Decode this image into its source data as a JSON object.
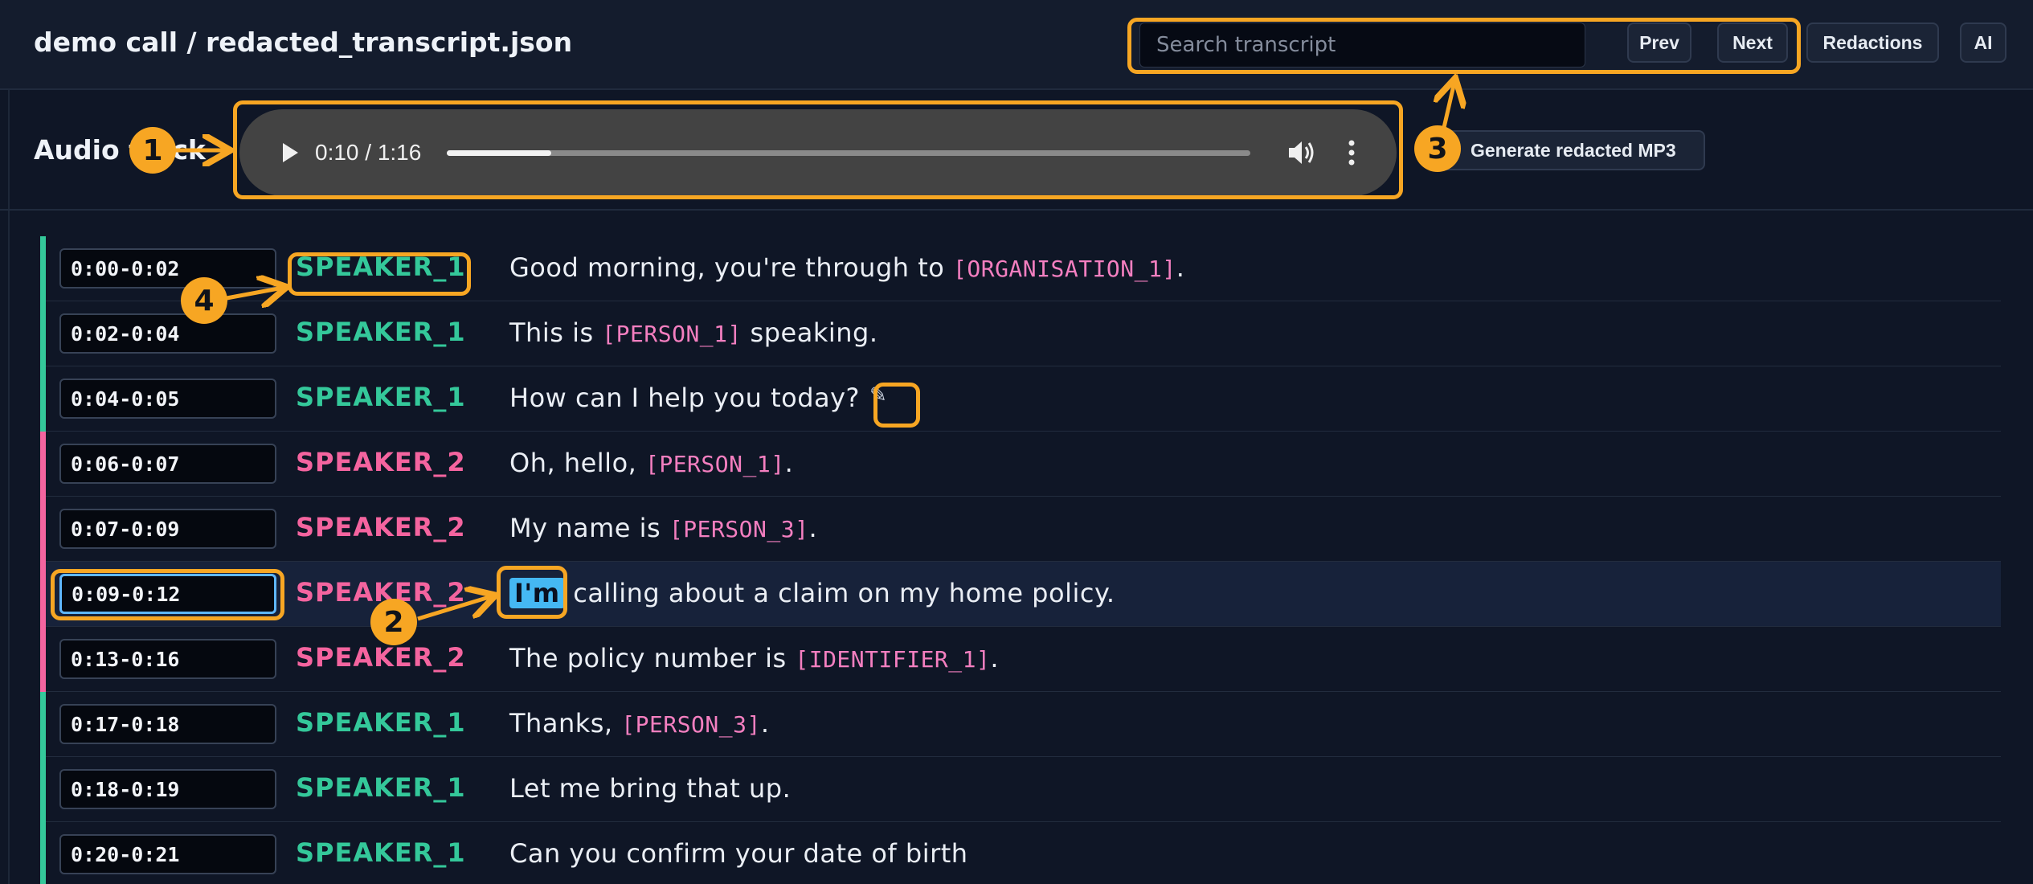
{
  "header": {
    "title": "demo call / redacted_transcript.json",
    "search_placeholder": "Search transcript",
    "search_value": "",
    "prev_label": "Prev",
    "next_label": "Next",
    "redactions_label": "Redactions",
    "ai_label": "AI"
  },
  "audio": {
    "label": "Audio track",
    "time": "0:10 / 1:16",
    "progress_fraction": 0.13,
    "generate_label": "Generate redacted MP3",
    "generate_icon": "speaker-icon"
  },
  "colors": {
    "speaker_1": "#34c89a",
    "speaker_2": "#f4649f",
    "tag": "#f47fc0",
    "highlight": "#45b8f3",
    "annotation": "#f7a623",
    "active_border": "#5fb7ff"
  },
  "segments": [
    {
      "time": "0:00-0:02",
      "speaker": "SPEAKER_1",
      "speaker_key": "speaker_1",
      "parts": [
        {
          "t": "Good morning, you're through to "
        },
        {
          "tag": "[ORGANISATION_1]"
        },
        {
          "t": "."
        }
      ]
    },
    {
      "time": "0:02-0:04",
      "speaker": "SPEAKER_1",
      "speaker_key": "speaker_1",
      "parts": [
        {
          "t": "This is "
        },
        {
          "tag": "[PERSON_1]"
        },
        {
          "t": " speaking."
        }
      ]
    },
    {
      "time": "0:04-0:05",
      "speaker": "SPEAKER_1",
      "speaker_key": "speaker_1",
      "parts": [
        {
          "t": "How can I help you today?"
        },
        {
          "icon": "✎"
        }
      ]
    },
    {
      "time": "0:06-0:07",
      "speaker": "SPEAKER_2",
      "speaker_key": "speaker_2",
      "parts": [
        {
          "t": "Oh, hello, "
        },
        {
          "tag": "[PERSON_1]"
        },
        {
          "t": "."
        }
      ]
    },
    {
      "time": "0:07-0:09",
      "speaker": "SPEAKER_2",
      "speaker_key": "speaker_2",
      "parts": [
        {
          "t": "My name is "
        },
        {
          "tag": "[PERSON_3]"
        },
        {
          "t": "."
        }
      ]
    },
    {
      "time": "0:09-0:12",
      "speaker": "SPEAKER_2",
      "speaker_key": "speaker_2",
      "active": true,
      "parts": [
        {
          "hl": "I'm"
        },
        {
          "t": " calling about a claim on my home policy."
        }
      ]
    },
    {
      "time": "0:13-0:16",
      "speaker": "SPEAKER_2",
      "speaker_key": "speaker_2",
      "parts": [
        {
          "t": "The policy number is "
        },
        {
          "tag": "[IDENTIFIER_1]"
        },
        {
          "t": "."
        }
      ]
    },
    {
      "time": "0:17-0:18",
      "speaker": "SPEAKER_1",
      "speaker_key": "speaker_1",
      "parts": [
        {
          "t": "Thanks, "
        },
        {
          "tag": "[PERSON_3]"
        },
        {
          "t": "."
        }
      ]
    },
    {
      "time": "0:18-0:19",
      "speaker": "SPEAKER_1",
      "speaker_key": "speaker_1",
      "parts": [
        {
          "t": "Let me bring that up."
        }
      ]
    },
    {
      "time": "0:20-0:21",
      "speaker": "SPEAKER_1",
      "speaker_key": "speaker_1",
      "parts": [
        {
          "t": "Can you confirm your date of birth"
        }
      ]
    }
  ],
  "annotations": [
    "1",
    "2",
    "3",
    "4"
  ]
}
